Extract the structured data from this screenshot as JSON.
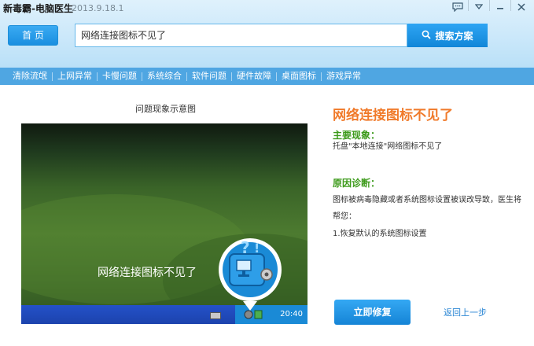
{
  "app": {
    "title": "新毒霸-电脑医生",
    "version": "2013.9.18.1"
  },
  "header": {
    "home_label": "首 页",
    "search_value": "网络连接图标不见了",
    "search_button_label": "搜索方案"
  },
  "nav": {
    "items": [
      {
        "label": "清除流氓"
      },
      {
        "label": "上网异常"
      },
      {
        "label": "卡慢问题"
      },
      {
        "label": "系统综合"
      },
      {
        "label": "软件问题"
      },
      {
        "label": "硬件故障"
      },
      {
        "label": "桌面图标"
      },
      {
        "label": "游戏异常"
      }
    ]
  },
  "illustration": {
    "caption": "问题现象示意图",
    "overlay_text": "网络连接图标不见了",
    "tray_time": "20:40"
  },
  "detail": {
    "title": "网络连接图标不见了",
    "symptom_label": "主要现象：",
    "symptom_text": "托盘\"本地连接\"网络图标不见了",
    "diagnosis_label": "原因诊断：",
    "diagnosis_line1": "图标被病毒隐藏或者系统图标设置被误改导致，医生将",
    "diagnosis_line2": "帮您：",
    "diagnosis_line3": "1.恢复默认的系统图标设置"
  },
  "actions": {
    "repair_label": "立即修复",
    "back_label": "返回上一步"
  },
  "colors": {
    "accent_blue": "#1a8fe0",
    "title_orange": "#f07a2a",
    "label_green": "#3c9a1a",
    "nav_bg": "#4fa6e2"
  }
}
